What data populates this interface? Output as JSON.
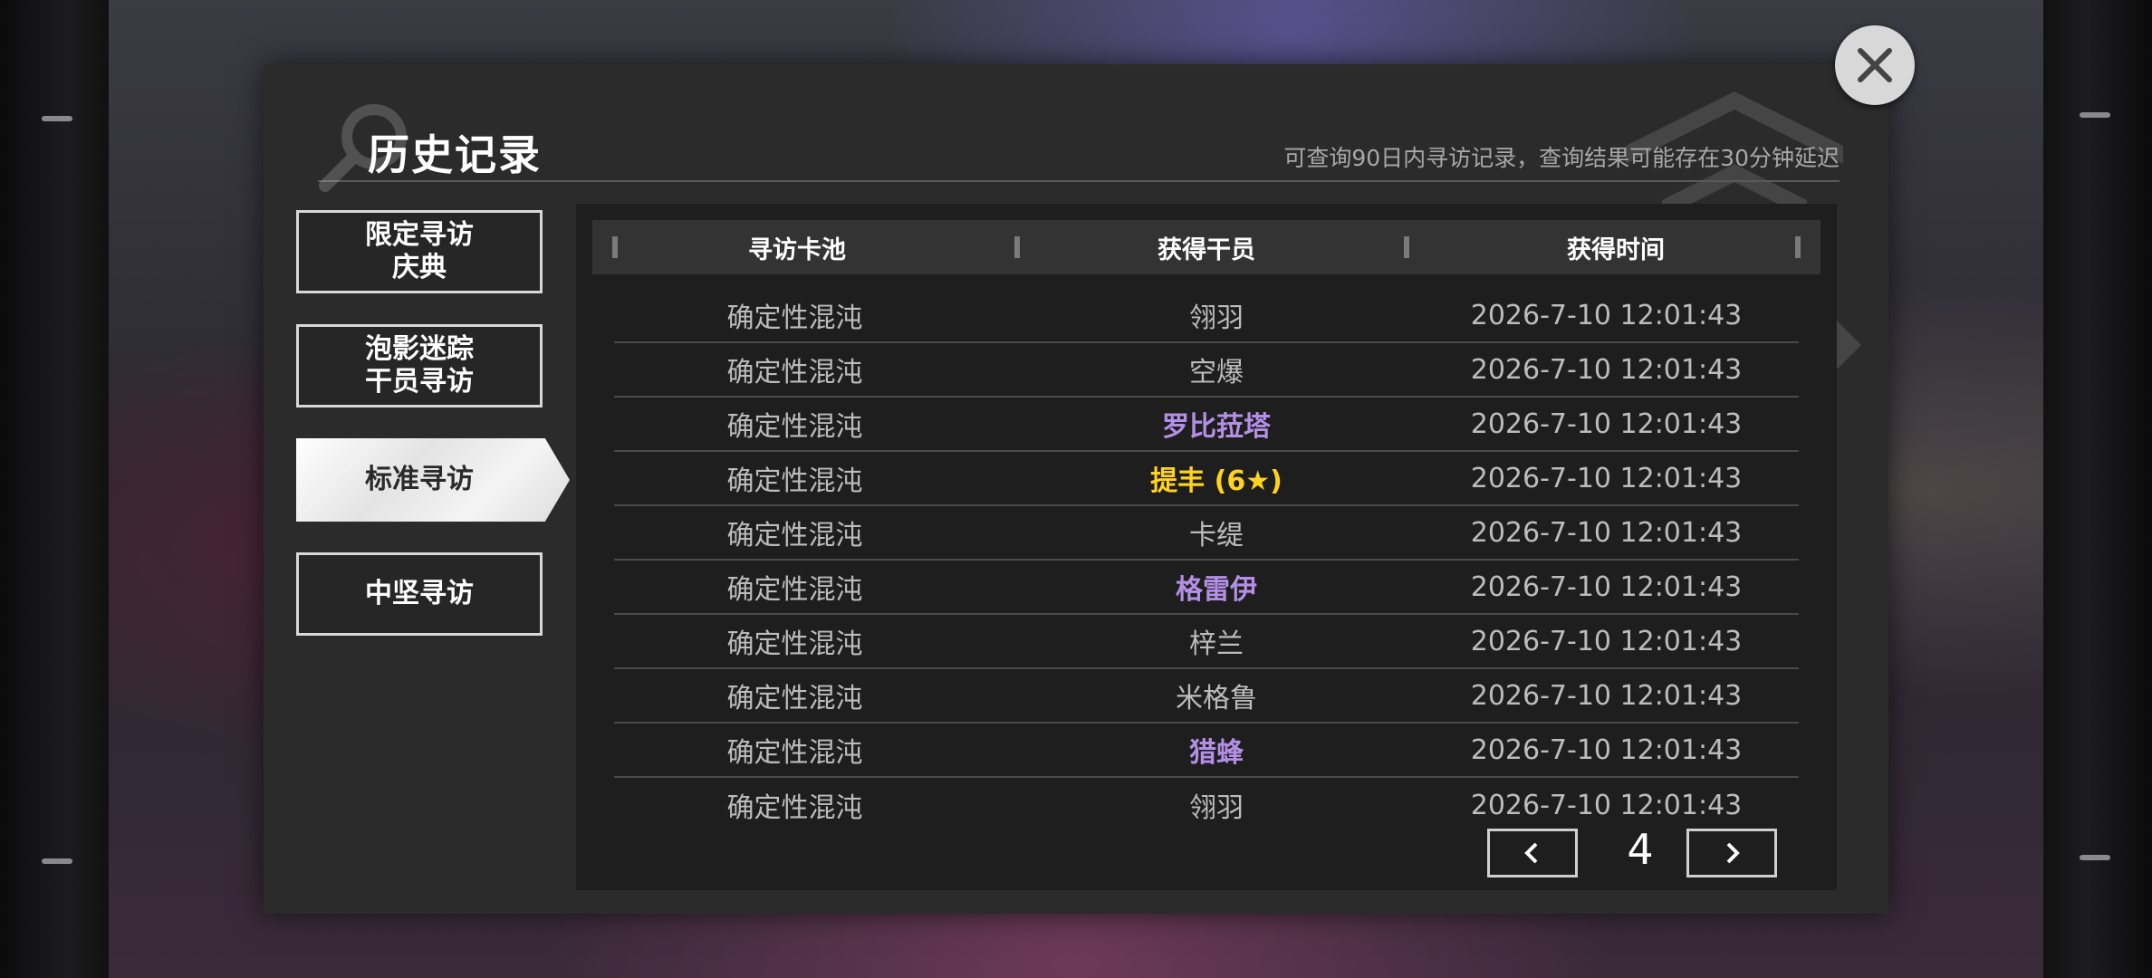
{
  "dialog": {
    "title": "历史记录",
    "subtitle": "可查询90日内寻访记录，查询结果可能存在30分钟延迟"
  },
  "tabs": [
    {
      "label": "限定寻访\n庆典",
      "active": false
    },
    {
      "label": "泡影迷踪\n干员寻访",
      "active": false
    },
    {
      "label": "标准寻访",
      "active": true
    },
    {
      "label": "中坚寻访",
      "active": false
    }
  ],
  "table": {
    "headers": [
      "寻访卡池",
      "获得干员",
      "获得时间"
    ],
    "rows": [
      {
        "pool": "确定性混沌",
        "operator": "翎羽",
        "time": "2026-7-10 12:01:43",
        "rarity": "normal"
      },
      {
        "pool": "确定性混沌",
        "operator": "空爆",
        "time": "2026-7-10 12:01:43",
        "rarity": "normal"
      },
      {
        "pool": "确定性混沌",
        "operator": "罗比菈塔",
        "time": "2026-7-10 12:01:43",
        "rarity": "purple"
      },
      {
        "pool": "确定性混沌",
        "operator": "提丰 (6★)",
        "time": "2026-7-10 12:01:43",
        "rarity": "gold"
      },
      {
        "pool": "确定性混沌",
        "operator": "卡缇",
        "time": "2026-7-10 12:01:43",
        "rarity": "normal"
      },
      {
        "pool": "确定性混沌",
        "operator": "格雷伊",
        "time": "2026-7-10 12:01:43",
        "rarity": "purple"
      },
      {
        "pool": "确定性混沌",
        "operator": "梓兰",
        "time": "2026-7-10 12:01:43",
        "rarity": "normal"
      },
      {
        "pool": "确定性混沌",
        "operator": "米格鲁",
        "time": "2026-7-10 12:01:43",
        "rarity": "normal"
      },
      {
        "pool": "确定性混沌",
        "operator": "猎蜂",
        "time": "2026-7-10 12:01:43",
        "rarity": "purple"
      },
      {
        "pool": "确定性混沌",
        "operator": "翎羽",
        "time": "2026-7-10 12:01:43",
        "rarity": "normal"
      }
    ]
  },
  "pagination": {
    "page": "4"
  },
  "colors": {
    "purple": "#b48fe6",
    "gold": "#ffd21f",
    "normal": "#bcbcbc"
  },
  "icons": {
    "close": "close-icon",
    "prev": "chevron-left-icon",
    "next": "chevron-right-icon",
    "search_deco": "search-icon"
  }
}
